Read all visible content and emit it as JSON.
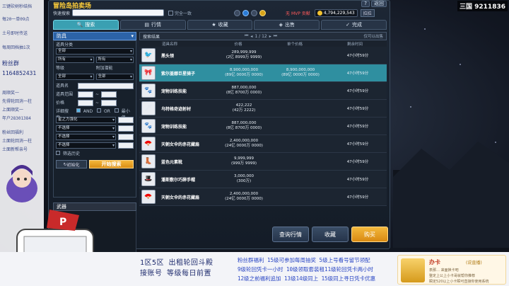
{
  "overlay_left": {
    "lines": [
      "三键砍树秒结挡",
      "每20一单09点",
      "土号即时传送",
      "每周回档抽1次",
      "粉丝群",
      "1164852431",
      "周顺奖一",
      "先得轮回消一柱",
      "上面顺奖一",
      "年户28301384",
      "粉丝回福利",
      "土面轮回消一柱",
      "土面新帮亲号"
    ]
  },
  "top_right_id": "三国 9211836",
  "panel": {
    "title": "冒险岛拍卖场",
    "win_buttons": [
      "?",
      "返回"
    ],
    "search_label": "快速搜索",
    "search_value": "",
    "exact_label": "完全一致",
    "mvp_label": "无 MVP 贡献",
    "meso": "4,794,229,543",
    "sort_label": "拉拉"
  },
  "tabs": [
    {
      "label": "搜索",
      "icon": "🔍"
    },
    {
      "label": "行情",
      "icon": "▤"
    },
    {
      "label": "收藏",
      "icon": "★"
    },
    {
      "label": "出售",
      "icon": "◈"
    },
    {
      "label": "完成",
      "icon": "✓"
    }
  ],
  "filter": {
    "category": "防具",
    "type_label": "道具分类",
    "type_values": [
      "全部",
      "所有",
      "所有"
    ],
    "slot_label": "等级",
    "slot2_label": "附加潜能",
    "slot_values": [
      "全部",
      "全部"
    ],
    "name_label": "道具名",
    "range_label": "道具范围",
    "price_label": "价格",
    "detail_label": "详细搜索",
    "and_label": "AND",
    "or_label": "OR",
    "min_label": "最小值",
    "opts": [
      "星之力强化",
      "不选择",
      "不选择",
      "不选择"
    ],
    "history_label": "筛选历史",
    "reset_label": "初始化",
    "search_btn": "开始搜索",
    "weapon_header": "武器"
  },
  "results": {
    "header": "搜索结果",
    "page": "1 / 12",
    "only_label": "仅可以出售",
    "col_name": "道具名称",
    "col_price": "价格",
    "col_unit": "单个价格",
    "col_time": "剩余时间",
    "rows": [
      {
        "name": "黑头领",
        "price1": "289,999,999",
        "price2": "(2亿 8999万 9999)",
        "unit1": "",
        "unit2": "",
        "time": "47小时59分",
        "icon": "🐦"
      },
      {
        "name": "紫尔盖娜巨星骑子",
        "price1": "8,900,000,000",
        "price2": "(89亿 0000万 0000)",
        "unit1": "8,900,000,000",
        "unit2": "(89亿 0000万 0000)",
        "time": "47小时59分",
        "icon": "🎀"
      },
      {
        "name": "宠物训练技能",
        "price1": "887,000,000",
        "price2": "(8亿 8700万 0000)",
        "unit1": "",
        "unit2": "",
        "time": "47小时59分",
        "icon": "🐾"
      },
      {
        "name": "乌特格奇迹射材",
        "price1": "422,222",
        "price2": "(42万 2222)",
        "unit1": "",
        "unit2": "",
        "time": "47小时59分",
        "icon": "🗡"
      },
      {
        "name": "宠物训练技能",
        "price1": "887,000,000",
        "price2": "(8亿 8700万 0000)",
        "unit1": "",
        "unit2": "",
        "time": "47小时59分",
        "icon": "🐾"
      },
      {
        "name": "天朝女伞的赤花藏扇",
        "price1": "2,400,000,000",
        "price2": "(24亿 0000万 0000)",
        "unit1": "",
        "unit2": "",
        "time": "47小时59分",
        "icon": "🪭"
      },
      {
        "name": "蓝色元素靴",
        "price1": "9,999,999",
        "price2": "(999万 9999)",
        "unit1": "",
        "unit2": "",
        "time": "47小时59分",
        "icon": "👢"
      },
      {
        "name": "潘斯敷尔巧薛手帽",
        "price1": "3,000,000",
        "price2": "(300万)",
        "unit1": "",
        "unit2": "",
        "time": "47小时59分",
        "icon": "🎩"
      },
      {
        "name": "天朝女伞的赤花藏扇",
        "price1": "2,400,000,000",
        "price2": "(24亿 0000万 0000)",
        "unit1": "",
        "unit2": "",
        "time": "47小时59分",
        "icon": "🪭"
      }
    ]
  },
  "actions": [
    "查询行情",
    "收藏",
    "购买"
  ],
  "banner": {
    "left_line1": "1区5区 出租轮回斗殿",
    "left_line2": "接账号 等级每日前置",
    "mid_line1": "粉丝群福利 15级可参加每周抽奖 5级上号看号留节领配",
    "mid_line2": "9级轮回凭卡一小时 10级领取套装租11级轮回凭卡两小时",
    "mid_line3": "12级之前福利追加 13级14级同上 15级同上寻日凭卡优惠"
  },
  "notif": {
    "title": "办卡",
    "tag": "(说直播)",
    "line1": "表那… 来面换卡吧",
    "line2": "整定上公上小卡哥就帮你推荐",
    "line3": "瞬定520以上小卡瞬可直接你使用系统"
  }
}
